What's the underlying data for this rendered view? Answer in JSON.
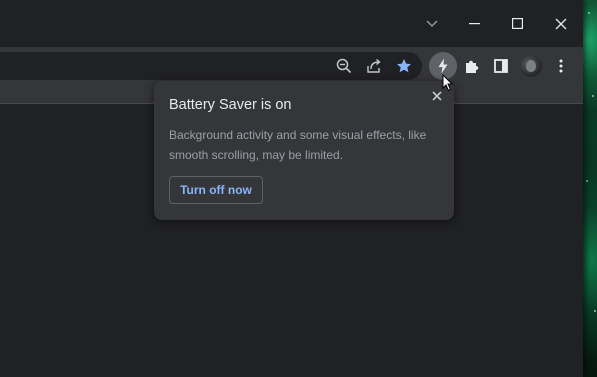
{
  "window_controls": {
    "dropdown_icon": "chevron-down-icon",
    "minimize_icon": "minimize-icon",
    "maximize_icon": "maximize-icon",
    "close_icon": "close-icon"
  },
  "toolbar": {
    "omnibox_icons": [
      "zoom-out-icon",
      "share-icon",
      "bookmark-star-icon"
    ],
    "battery_saver_icon": "lightning-bolt-icon",
    "extensions_icon": "puzzle-piece-icon",
    "side_panel_icon": "side-panel-icon",
    "menu_icon": "three-dots-vertical-icon"
  },
  "battery_popup": {
    "title": "Battery Saver is on",
    "body": "Background activity and some visual effects, like smooth scrolling, may be limited.",
    "button_label": "Turn off now",
    "accent_color": "#8ab4f8"
  },
  "colors": {
    "window_bg": "#202124",
    "toolbar_bg": "#35363a",
    "text_primary": "#e8eaed",
    "text_secondary": "#9aa0a6"
  }
}
